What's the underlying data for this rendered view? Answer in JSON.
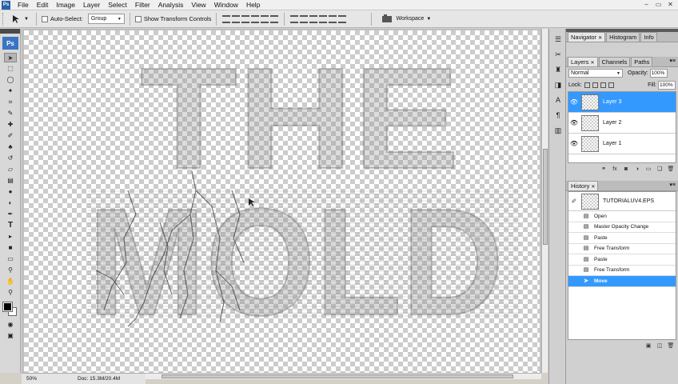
{
  "app": {
    "logo": "Ps"
  },
  "menu": [
    "File",
    "Edit",
    "Image",
    "Layer",
    "Select",
    "Filter",
    "Analysis",
    "View",
    "Window",
    "Help"
  ],
  "window_controls": {
    "minimize": "–",
    "restore": "▭",
    "close": "✕"
  },
  "options": {
    "tool_icon": "move-tool-icon",
    "auto_select_label": "Auto-Select:",
    "auto_select_value": "Group",
    "show_transform_label": "Show Transform Controls",
    "workspace_label": "Workspace"
  },
  "toolbox": {
    "tools": [
      "move-tool-icon",
      "marquee-tool-icon",
      "lasso-tool-icon",
      "magic-wand-icon",
      "crop-tool-icon",
      "slice-tool-icon",
      "healing-brush-icon",
      "brush-tool-icon",
      "clone-stamp-icon",
      "history-brush-icon",
      "eraser-tool-icon",
      "gradient-tool-icon",
      "blur-tool-icon",
      "dodge-tool-icon",
      "pen-tool-icon",
      "type-tool-icon",
      "path-selection-icon",
      "shape-tool-icon",
      "notes-tool-icon",
      "eyedropper-icon",
      "hand-tool-icon",
      "zoom-tool-icon"
    ],
    "foreground_color": "#000000",
    "background_color": "#ffffff"
  },
  "canvas": {
    "title_line1": "THE",
    "title_line2": "MOLD",
    "zoom": "50%",
    "doc_size": "Doc: 15.3M/20.4M"
  },
  "panel_top": {
    "tabs": [
      {
        "label": "Navigator",
        "active": true
      },
      {
        "label": "Histogram",
        "active": false
      },
      {
        "label": "Info",
        "active": false
      }
    ]
  },
  "layers_panel": {
    "tabs": [
      {
        "label": "Layers",
        "active": true
      },
      {
        "label": "Channels",
        "active": false
      },
      {
        "label": "Paths",
        "active": false
      }
    ],
    "blend_mode": "Normal",
    "opacity_label": "Opacity:",
    "opacity_value": "100%",
    "lock_label": "Lock:",
    "fill_label": "Fill:",
    "fill_value": "100%",
    "layers": [
      {
        "name": "Layer 3",
        "selected": true
      },
      {
        "name": "Layer 2",
        "selected": false
      },
      {
        "name": "Layer 1",
        "selected": false
      }
    ],
    "footer_icons": [
      "link-icon",
      "fx-icon",
      "mask-icon",
      "adjustment-icon",
      "group-icon",
      "new-layer-icon",
      "trash-icon"
    ]
  },
  "history_panel": {
    "tab": "History",
    "snapshot": "TUTORIALUV4.EPS",
    "steps": [
      {
        "label": "Open",
        "selected": false
      },
      {
        "label": "Master Opacity Change",
        "selected": false
      },
      {
        "label": "Paste",
        "selected": false
      },
      {
        "label": "Free Transform",
        "selected": false
      },
      {
        "label": "Paste",
        "selected": false
      },
      {
        "label": "Free Transform",
        "selected": false
      },
      {
        "label": "Move",
        "selected": true
      }
    ]
  },
  "colors": {
    "selection": "#3399ff",
    "accent": "#3a75c4"
  }
}
